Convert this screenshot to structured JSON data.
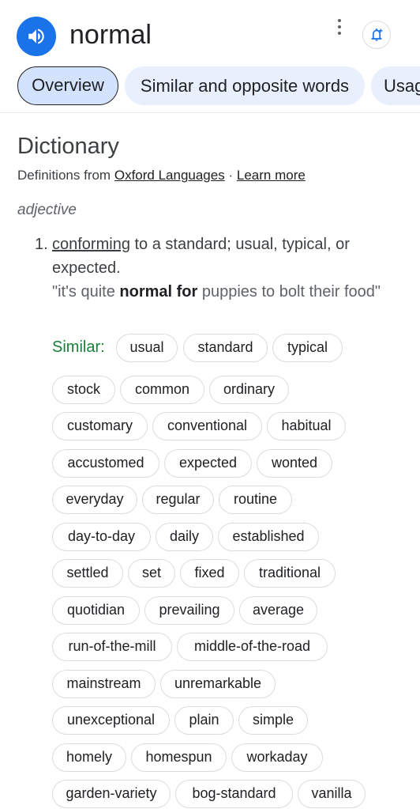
{
  "header": {
    "word": "normal"
  },
  "tabs": [
    "Overview",
    "Similar and opposite words",
    "Usag"
  ],
  "dictionary": {
    "title": "Dictionary",
    "source_prefix": "Definitions from",
    "source_link": "Oxford Languages",
    "separator": "·",
    "learn_more": "Learn more",
    "part_of_speech": "adjective",
    "definition": {
      "number": "1.",
      "linked_word": "conforming",
      "text_rest": " to a standard; usual, typical, or expected.",
      "example_open": "\"it's quite ",
      "example_bold": "normal for",
      "example_close": " puppies to bolt their food\""
    },
    "similar_label": "Similar:",
    "similar_rows": [
      [
        "usual",
        "standard",
        "typical"
      ],
      [
        "stock",
        "common",
        "ordinary"
      ],
      [
        "customary",
        "conventional",
        "habitual"
      ],
      [
        "accustomed",
        "expected",
        "wonted"
      ],
      [
        "everyday",
        "regular",
        "routine"
      ],
      [
        "day-to-day",
        "daily",
        "established"
      ],
      [
        "settled",
        "set",
        "fixed",
        "traditional"
      ],
      [
        "quotidian",
        "prevailing",
        "average"
      ],
      [
        "run-of-the-mill",
        "middle-of-the-road"
      ],
      [
        "mainstream",
        "unremarkable"
      ],
      [
        "unexceptional",
        "plain",
        "simple"
      ],
      [
        "homely",
        "homespun",
        "workaday"
      ],
      [
        "garden-variety",
        "bog-standard",
        "vanilla"
      ]
    ]
  },
  "icons": {
    "speaker": "volume-icon",
    "more": "more-vert-icon",
    "alert": "add-alert-icon"
  },
  "colors": {
    "accent": "#1a73e8",
    "tab_bg": "#e8f0fe",
    "similar_label": "#188038"
  }
}
